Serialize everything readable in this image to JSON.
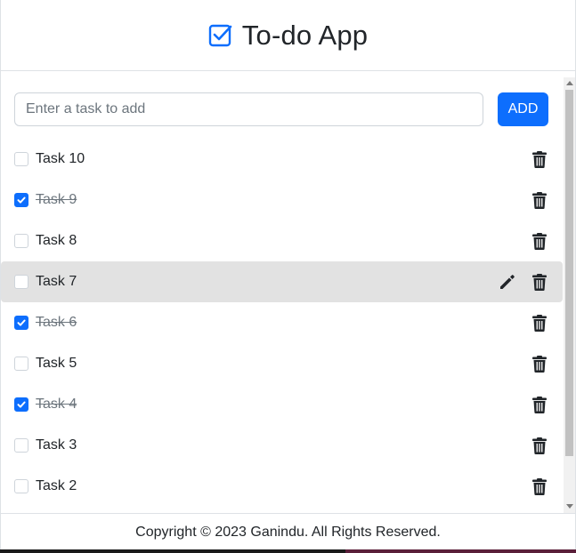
{
  "header": {
    "title": "To-do App",
    "icon": "check-square-icon",
    "icon_color": "#0d6efd"
  },
  "form": {
    "placeholder": "Enter a task to add",
    "value": "",
    "add_label": "ADD"
  },
  "tasks": [
    {
      "label": "Task 10",
      "done": false
    },
    {
      "label": "Task 9",
      "done": true
    },
    {
      "label": "Task 8",
      "done": false
    },
    {
      "label": "Task 7",
      "done": false,
      "hovered": true
    },
    {
      "label": "Task 6",
      "done": true
    },
    {
      "label": "Task 5",
      "done": false
    },
    {
      "label": "Task 4",
      "done": true
    },
    {
      "label": "Task 3",
      "done": false
    },
    {
      "label": "Task 2",
      "done": false
    }
  ],
  "footer": {
    "text": "Copyright © 2023 Ganindu. All Rights Reserved."
  },
  "colors": {
    "primary": "#0d6efd",
    "hover_row": "#e2e2e2",
    "text": "#212529"
  }
}
